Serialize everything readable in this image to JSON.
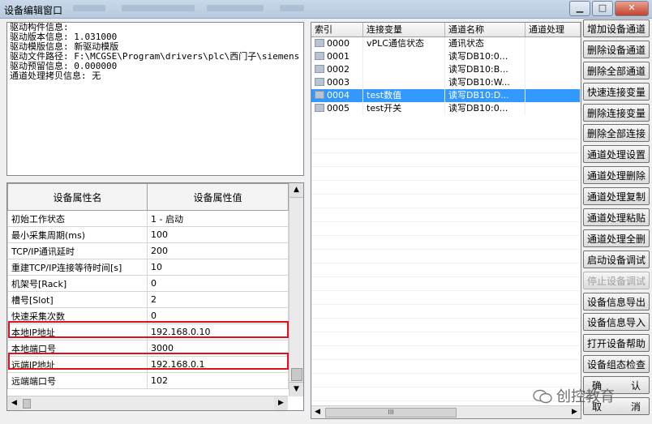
{
  "window": {
    "title": "设备编辑窗口"
  },
  "info": {
    "lines": [
      "驱动构件信息:",
      "驱动版本信息: 1.031000",
      "驱动模版信息: 新驱动模版",
      "驱动文件路径: F:\\MCGSE\\Program\\drivers\\plc\\西门子\\siemens",
      "驱动预留信息: 0.000000",
      "通道处理拷贝信息: 无"
    ]
  },
  "properties": {
    "headers": [
      "设备属性名",
      "设备属性值"
    ],
    "rows": [
      [
        "初始工作状态",
        "1 - 启动"
      ],
      [
        "最小采集周期(ms)",
        "100"
      ],
      [
        "TCP/IP通讯延时",
        "200"
      ],
      [
        "重建TCP/IP连接等待时间[s]",
        "10"
      ],
      [
        "机架号[Rack]",
        "0"
      ],
      [
        "槽号[Slot]",
        "2"
      ],
      [
        "快速采集次数",
        "0"
      ],
      [
        "本地IP地址",
        "192.168.0.10"
      ],
      [
        "本地端口号",
        "3000"
      ],
      [
        "远端IP地址",
        "192.168.0.1"
      ],
      [
        "远端端口号",
        "102"
      ]
    ]
  },
  "channels": {
    "headers": [
      "索引",
      "连接变量",
      "通道名称",
      "通道处理"
    ],
    "rows": [
      [
        "0000",
        "vPLC通信状态",
        "通讯状态",
        ""
      ],
      [
        "0001",
        "",
        "读写DB10:0...",
        ""
      ],
      [
        "0002",
        "",
        "读写DB10:B...",
        ""
      ],
      [
        "0003",
        "",
        "读写DB10:W...",
        ""
      ],
      [
        "0004",
        "test数值",
        "读写DB10:D...",
        ""
      ],
      [
        "0005",
        "test开关",
        "读写DB10:0...",
        ""
      ]
    ],
    "selected_index": "0004",
    "scroll_thumb_label": "III"
  },
  "buttons": [
    {
      "label": "增加设备通道",
      "enabled": true
    },
    {
      "label": "删除设备通道",
      "enabled": true
    },
    {
      "label": "删除全部通道",
      "enabled": true
    },
    {
      "label": "快速连接变量",
      "enabled": true
    },
    {
      "label": "删除连接变量",
      "enabled": true
    },
    {
      "label": "删除全部连接",
      "enabled": true
    },
    {
      "label": "通道处理设置",
      "enabled": true
    },
    {
      "label": "通道处理删除",
      "enabled": true
    },
    {
      "label": "通道处理复制",
      "enabled": true
    },
    {
      "label": "通道处理粘贴",
      "enabled": true
    },
    {
      "label": "通道处理全删",
      "enabled": true
    },
    {
      "label": "启动设备调试",
      "enabled": true
    },
    {
      "label": "停止设备调试",
      "enabled": false
    },
    {
      "label": "设备信息导出",
      "enabled": true
    },
    {
      "label": "设备信息导入",
      "enabled": true
    },
    {
      "label": "打开设备帮助",
      "enabled": true
    },
    {
      "label": "设备组态检查",
      "enabled": true
    },
    {
      "label": "确 认",
      "enabled": true
    },
    {
      "label": "取 消",
      "enabled": true
    }
  ],
  "watermark": {
    "text": "创控教育"
  },
  "colors": {
    "highlight_box": "#e0101c",
    "selection": "#3399ff"
  }
}
